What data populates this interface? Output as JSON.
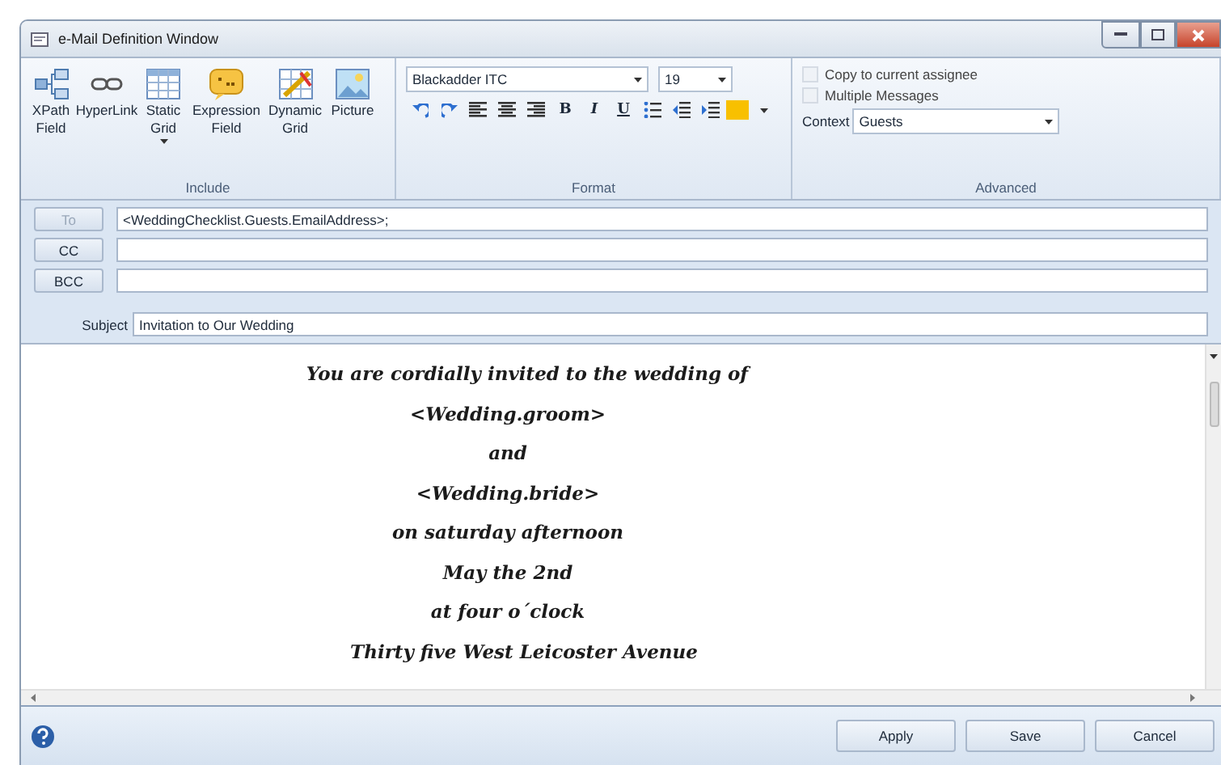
{
  "window": {
    "title": "e-Mail Definition Window"
  },
  "ribbon": {
    "include": {
      "label": "Include",
      "items": [
        {
          "lines": [
            "XPath",
            "Field"
          ],
          "has_menu": false
        },
        {
          "lines": [
            "HyperLink"
          ],
          "has_menu": false
        },
        {
          "lines": [
            "Static",
            "Grid"
          ],
          "has_menu": true
        },
        {
          "lines": [
            "Expression",
            "Field"
          ],
          "has_menu": false
        },
        {
          "lines": [
            "Dynamic",
            "Grid"
          ],
          "has_menu": false
        },
        {
          "lines": [
            "Picture"
          ],
          "has_menu": false
        }
      ]
    },
    "format": {
      "label": "Format",
      "font": "Blackadder ITC",
      "size": "19",
      "bold": "B",
      "italic": "I",
      "underline": "U"
    },
    "advanced": {
      "label": "Advanced",
      "options": [
        {
          "label": "Copy to current assignee",
          "checked": false,
          "disabled": true
        },
        {
          "label": "Multiple Messages",
          "checked": false,
          "disabled": true
        }
      ],
      "context_label": "Context",
      "context_value": "Guests"
    }
  },
  "addresses": [
    {
      "label": "To",
      "disabled": true,
      "value": "<WeddingChecklist.Guests.EmailAddress>;"
    },
    {
      "label": "CC",
      "disabled": false
    },
    {
      "label": "BCC",
      "disabled": false
    }
  ],
  "subject": {
    "label": "Subject",
    "value": "Invitation to Our Wedding"
  },
  "body": [
    "You are cordially invited to the wedding of",
    "<Wedding.groom>",
    "and",
    "<Wedding.bride>",
    "on saturday afternoon",
    "May the 2nd",
    "at four o´clock",
    "Thirty five West Leicoster Avenue"
  ],
  "buttons": [
    "Apply",
    "Save",
    "Cancel"
  ]
}
